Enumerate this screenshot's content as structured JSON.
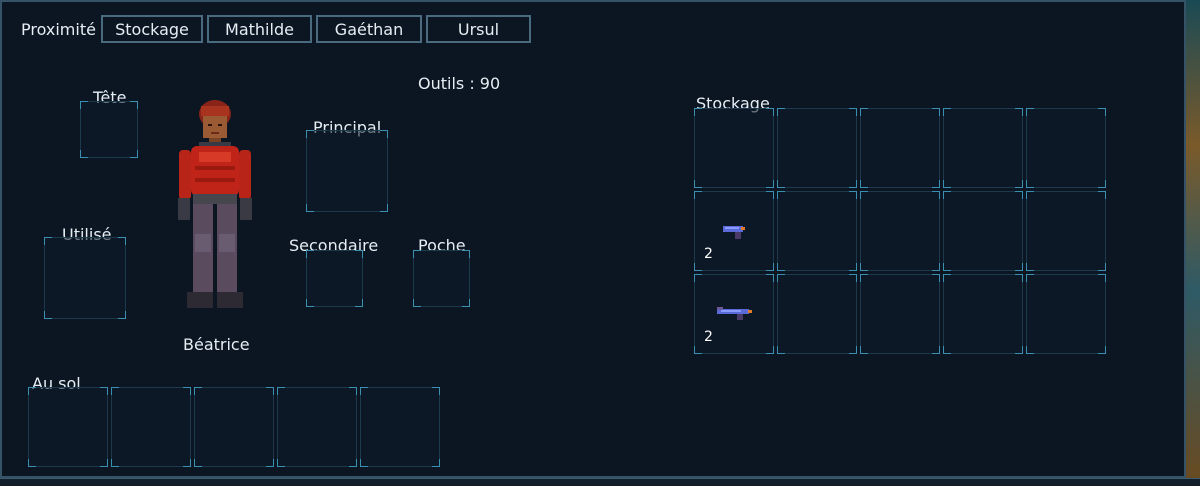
{
  "tabs": {
    "proximity_label": "Proximité",
    "items": [
      "Stockage",
      "Mathilde",
      "Gaéthan",
      "Ursul"
    ]
  },
  "equipment": {
    "head": "Tête",
    "used": "Utilisé",
    "main": "Principal",
    "secondary": "Secondaire",
    "pocket": "Poche",
    "tools": "Outils : 90",
    "character_name": "Béatrice"
  },
  "ground": {
    "label": "Au sol"
  },
  "storage": {
    "label": "Stockage",
    "items": [
      {
        "name": "pistol-icon",
        "quantity": "2"
      },
      {
        "name": "rifle-icon",
        "quantity": "2"
      }
    ]
  },
  "colors": {
    "accent": "#3a90b0",
    "panel": "#0b1622",
    "border": "#365267"
  }
}
